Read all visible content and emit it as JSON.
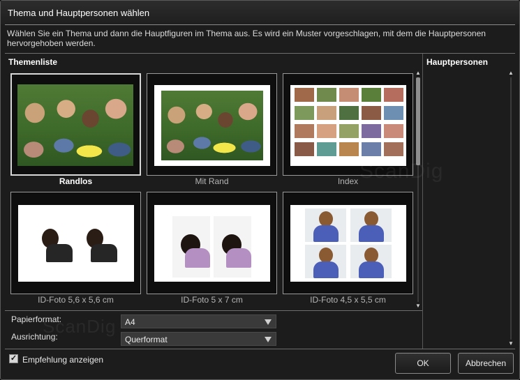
{
  "dialog": {
    "title": "Thema und Hauptpersonen wählen",
    "description": "Wählen Sie ein Thema und dann die Hauptfiguren im Thema aus. Es wird ein Muster vorgeschlagen, mit dem die Hauptpersonen hervorgehoben werden."
  },
  "theme_list": {
    "heading": "Themenliste",
    "items": [
      {
        "label": "Randlos",
        "selected": true
      },
      {
        "label": "Mit Rand",
        "selected": false
      },
      {
        "label": "Index",
        "selected": false
      },
      {
        "label": "ID-Foto 5,6 x 5,6 cm",
        "selected": false
      },
      {
        "label": "ID-Foto 5 x 7 cm",
        "selected": false
      },
      {
        "label": "ID-Foto 4,5 x 5,5 cm",
        "selected": false
      }
    ]
  },
  "main_persons": {
    "heading": "Hauptpersonen"
  },
  "settings": {
    "paper_format_label": "Papierformat:",
    "paper_format_value": "A4",
    "orientation_label": "Ausrichtung:",
    "orientation_value": "Querformat"
  },
  "footer": {
    "recommendation_label": "Empfehlung anzeigen",
    "recommendation_checked": true,
    "ok_label": "OK",
    "cancel_label": "Abbrechen"
  },
  "watermark": "ScanDig",
  "icons": {
    "dropdown": "chevron-down-icon",
    "scroll_up": "arrow-up-icon",
    "scroll_down": "arrow-down-icon",
    "check": "checkmark-icon"
  }
}
